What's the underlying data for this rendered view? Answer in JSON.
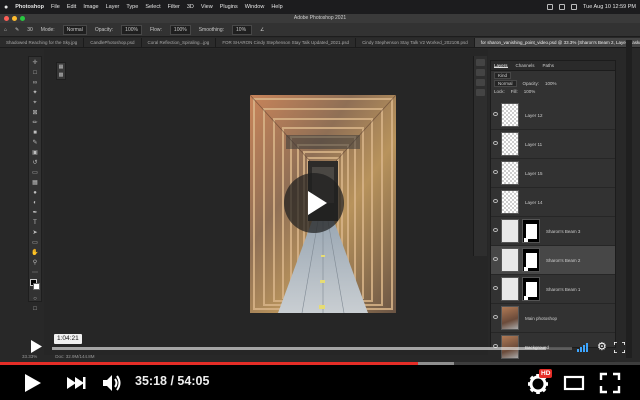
{
  "mac_menubar": {
    "apple": "",
    "app": "Photoshop",
    "items": [
      "File",
      "Edit",
      "Image",
      "Layer",
      "Type",
      "Select",
      "Filter",
      "3D",
      "View",
      "Plugins",
      "Window",
      "Help"
    ],
    "clock": "Tue Aug 10 12:59 PM"
  },
  "ps_window": {
    "title": "Adobe Photoshop 2021"
  },
  "ps_options": {
    "mode_label": "Mode:",
    "mode_value": "Normal",
    "opacity_label": "Opacity:",
    "opacity_value": "100%",
    "flow_label": "Flow:",
    "flow_value": "100%",
    "smoothing_label": "Smoothing:",
    "smoothing_value": "10%"
  },
  "ps_tabs": [
    "Shadowed Reaching for the Sky.jpg",
    "CandlePhotoshop.psd",
    "Coral Reflection_Spiraling...jpg",
    "FOR SHARON Cindy Stephenson Stay Talk Updated_2021.psd",
    "Cindy Stephenson Stay Talk V2 Worked_202108.psd",
    "for sharon_vanishing_point_video.psd @ 33.3% (Sharon's Beam 2, Layer Mask/16) *"
  ],
  "layers_panel": {
    "tabs": [
      "Layers",
      "Channels",
      "Paths"
    ],
    "kind_label": "Kind",
    "blend_mode": "Normal",
    "opacity_label": "Opacity:",
    "opacity_value": "100%",
    "lock_label": "Lock:",
    "fill_label": "Fill:",
    "fill_value": "100%",
    "rows": [
      {
        "name": "Layer 12",
        "thumb": "checker",
        "mask": false,
        "selected": false
      },
      {
        "name": "Layer 11",
        "thumb": "checker",
        "mask": false,
        "selected": false
      },
      {
        "name": "Layer 15",
        "thumb": "checker",
        "mask": false,
        "selected": false
      },
      {
        "name": "Layer 14",
        "thumb": "checker",
        "mask": false,
        "selected": false
      },
      {
        "name": "Sharon's Beam 3",
        "thumb": "plain",
        "mask": true,
        "selected": false
      },
      {
        "name": "Sharon's Beam 2",
        "thumb": "plain",
        "mask": true,
        "selected": true
      },
      {
        "name": "Sharon's Beam 1",
        "thumb": "plain",
        "mask": true,
        "selected": false
      },
      {
        "name": "Main photoshop",
        "thumb": "photo",
        "mask": false,
        "selected": false
      },
      {
        "name": "Background",
        "thumb": "photo",
        "mask": false,
        "selected": false
      }
    ]
  },
  "ps_status": {
    "zoom": "33.33%",
    "doc": "Doc: 32.9M/144.8M"
  },
  "player": {
    "hover_time": "1:04:21",
    "current_time": "35:18",
    "duration": "54:05",
    "hd_badge": "HD",
    "played_fraction": 0.653,
    "loaded_fraction": 0.71,
    "mini_buffer_fraction": 0.95
  },
  "colors": {
    "accent_red": "#e52d27",
    "ps_bg": "#282828",
    "panel_bg": "#323232"
  },
  "icons": {
    "center": "play-icon",
    "play": "play-icon",
    "next": "next-icon",
    "volume": "volume-icon",
    "settings": "gear-icon",
    "theater": "theater-mode-icon",
    "fullscreen": "fullscreen-icon"
  }
}
